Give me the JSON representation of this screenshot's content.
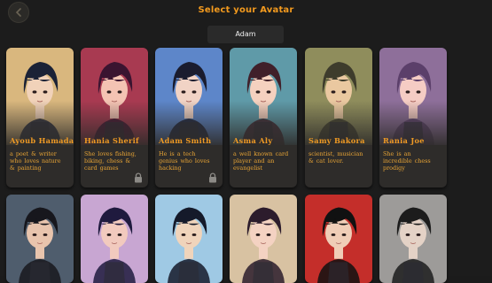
{
  "header": {
    "title": "Select your Avatar",
    "back_icon": "back-arrow-icon"
  },
  "selected_name": "Adam",
  "avatars": [
    {
      "name": "Ayoub Hamada",
      "desc": "a poet & writer who loves nature & painting",
      "locked": false,
      "bg": "#d9b77e",
      "hair": "#1b2236",
      "skin": "#f1d2b9"
    },
    {
      "name": "Hania Sherif",
      "desc": "She loves fishing, biking, chess & card games",
      "locked": true,
      "bg": "#a83a51",
      "hair": "#3a1430",
      "skin": "#f4c3b3"
    },
    {
      "name": "Adam Smith",
      "desc": "He is a tech genius who loves hacking",
      "locked": true,
      "bg": "#5d86c9",
      "hair": "#1a1c2e",
      "skin": "#f1d3c5"
    },
    {
      "name": "Asma Aly",
      "desc": "a well known card player and an evangelist",
      "locked": false,
      "bg": "#5f9aa8",
      "hair": "#40202a",
      "skin": "#f5d1bf"
    },
    {
      "name": "Samy Bakora",
      "desc": "scientist, musician & cat lover.",
      "locked": false,
      "bg": "#8f8d5c",
      "hair": "#3e3c2c",
      "skin": "#eac8a0"
    },
    {
      "name": "Rania Joe",
      "desc": "She is an incredible chess prodigy",
      "locked": false,
      "bg": "#8e6f9a",
      "hair": "#5b3f6a",
      "skin": "#f5ccc4"
    }
  ],
  "avatars_row2": [
    {
      "bg": "#4f5d6d",
      "hair": "#17171d",
      "skin": "#e8c4ad"
    },
    {
      "bg": "#c8a6d2",
      "hair": "#1f1a3e",
      "skin": "#f2cabe"
    },
    {
      "bg": "#9fc9e4",
      "hair": "#151a2a",
      "skin": "#f0d4bb"
    },
    {
      "bg": "#d8c2a2",
      "hair": "#2c1c2c",
      "skin": "#f4d2c2"
    },
    {
      "bg": "#c42e2a",
      "hair": "#111111",
      "skin": "#f0cdb7"
    },
    {
      "bg": "#9d9b99",
      "hair": "#1c1c1c",
      "skin": "#e4d2c6"
    }
  ],
  "lock_icon": "lock-icon"
}
